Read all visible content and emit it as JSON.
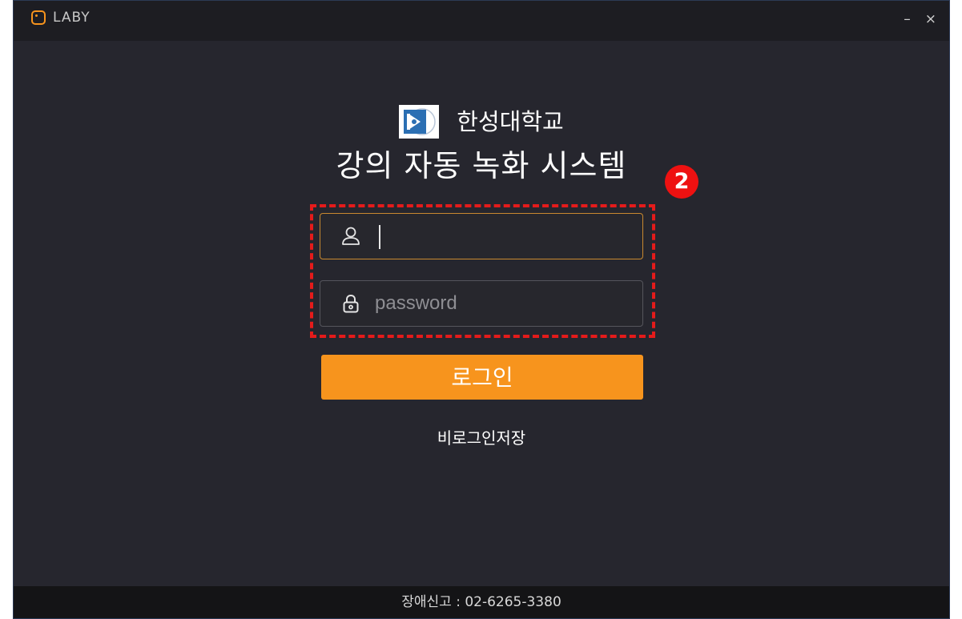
{
  "window": {
    "brand_name": "LABY",
    "minimize_glyph": "–",
    "close_glyph": "×"
  },
  "header": {
    "university_name": "한성대학교",
    "system_title": "강의 자동 녹화 시스템"
  },
  "annotation": {
    "step_number": "2",
    "color": "#e41b1b"
  },
  "form": {
    "username": {
      "value": "",
      "placeholder": "",
      "icon": "user-icon"
    },
    "password": {
      "value": "",
      "placeholder": "password",
      "icon": "lock-icon"
    },
    "login_label": "로그인",
    "save_login_label": "비로그인저장"
  },
  "footer": {
    "support_text": "장애신고 : 02-6265-3380"
  },
  "colors": {
    "accent": "#f7941d",
    "background": "#26262e",
    "titlebar": "#1d1d22",
    "footer": "#141416"
  }
}
